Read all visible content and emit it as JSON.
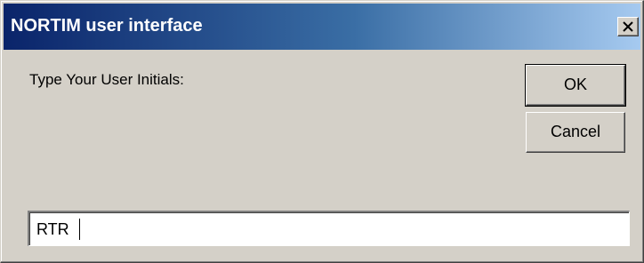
{
  "window": {
    "title": "NORTIM user interface"
  },
  "titlebar": {
    "close_icon": "close-icon"
  },
  "dialog": {
    "prompt": "Type Your User Initials:",
    "ok_label": "OK",
    "cancel_label": "Cancel",
    "initials_value": "RTR"
  },
  "colors": {
    "titlebar_start": "#0a246a",
    "titlebar_end": "#a6caf0",
    "face": "#d4d0c8"
  }
}
